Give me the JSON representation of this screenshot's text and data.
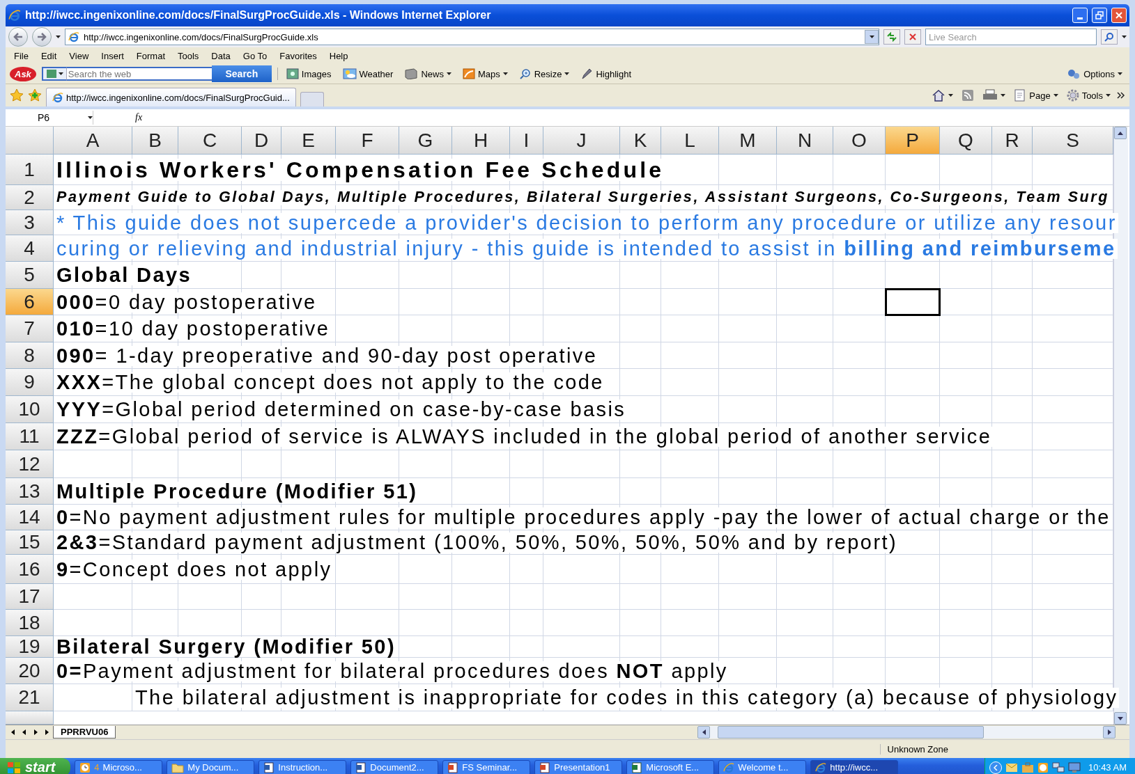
{
  "window": {
    "title": "http://iwcc.ingenixonline.com/docs/FinalSurgProcGuide.xls - Windows Internet Explorer"
  },
  "address_bar": {
    "url": "http://iwcc.ingenixonline.com/docs/FinalSurgProcGuide.xls",
    "search_placeholder": "Live Search"
  },
  "menu": [
    "File",
    "Edit",
    "View",
    "Insert",
    "Format",
    "Tools",
    "Data",
    "Go To",
    "Favorites",
    "Help"
  ],
  "ask_toolbar": {
    "logo": "Ask",
    "search_placeholder": "Search the web",
    "search_button": "Search",
    "options": "Options",
    "buttons": [
      {
        "label": "Images",
        "kind": "images",
        "dropdown": false
      },
      {
        "label": "Weather",
        "kind": "weather",
        "dropdown": false
      },
      {
        "label": "News",
        "kind": "news",
        "dropdown": true
      },
      {
        "label": "Maps",
        "kind": "maps",
        "dropdown": true
      },
      {
        "label": "Resize",
        "kind": "resize",
        "dropdown": true
      },
      {
        "label": "Highlight",
        "kind": "highlight",
        "dropdown": false
      }
    ]
  },
  "tabs": [
    {
      "label": "http://iwcc.ingenixonline.com/docs/FinalSurgProcGuid...",
      "selected": true
    }
  ],
  "command_bar": [
    "Page",
    "Tools"
  ],
  "formula_bar": {
    "name_box": "P6",
    "fx": "fx"
  },
  "columns": [
    {
      "label": "A",
      "selected": false
    },
    {
      "label": "B",
      "selected": false
    },
    {
      "label": "C",
      "selected": false
    },
    {
      "label": "D",
      "selected": false
    },
    {
      "label": "E",
      "selected": false
    },
    {
      "label": "F",
      "selected": false
    },
    {
      "label": "G",
      "selected": false
    },
    {
      "label": "H",
      "selected": false
    },
    {
      "label": "I",
      "selected": false
    },
    {
      "label": "J",
      "selected": false
    },
    {
      "label": "K",
      "selected": false
    },
    {
      "label": "L",
      "selected": false
    },
    {
      "label": "M",
      "selected": false
    },
    {
      "label": "N",
      "selected": false
    },
    {
      "label": "O",
      "selected": false
    },
    {
      "label": "P",
      "selected": true
    },
    {
      "label": "Q",
      "selected": false
    },
    {
      "label": "R",
      "selected": false
    },
    {
      "label": "S",
      "selected": false
    }
  ],
  "rows": [
    {
      "number": "1",
      "selected": false,
      "kind": "title",
      "indented": false,
      "text": "Illinois Workers' Compensation Fee Schedule"
    },
    {
      "number": "2",
      "selected": false,
      "kind": "subtitle",
      "indented": false,
      "text": "Payment Guide to Global Days, Multiple Procedures, Bilateral Surgeries, Assistant Surgeons, Co-Surgeons, Team Surg"
    },
    {
      "number": "3",
      "selected": false,
      "kind": "note",
      "indented": false,
      "text": "* This guide does not supercede a provider's decision to perform any procedure or utilize any resour"
    },
    {
      "number": "4",
      "selected": false,
      "kind": "note",
      "indented": false,
      "text": "curing or relieving and industrial injury - this guide is intended to assist in **billing and reimburseme**"
    },
    {
      "number": "5",
      "selected": false,
      "kind": "heading",
      "indented": false,
      "text": "Global Days"
    },
    {
      "number": "6",
      "selected": true,
      "kind": "body",
      "indented": false,
      "text": "**000**=0 day postoperative"
    },
    {
      "number": "7",
      "selected": false,
      "kind": "body",
      "indented": false,
      "text": "**010**=10 day postoperative"
    },
    {
      "number": "8",
      "selected": false,
      "kind": "body",
      "indented": false,
      "text": "**090**= 1-day preoperative and 90-day post operative"
    },
    {
      "number": "9",
      "selected": false,
      "kind": "body",
      "indented": false,
      "text": "**XXX**=The global concept does not apply to the code"
    },
    {
      "number": "10",
      "selected": false,
      "kind": "body",
      "indented": false,
      "text": "**YYY**=Global period determined on case-by-case basis"
    },
    {
      "number": "11",
      "selected": false,
      "kind": "body",
      "indented": false,
      "text": "**ZZZ**=Global period of service is ALWAYS included in the global period of another service"
    },
    {
      "number": "12",
      "selected": false
    },
    {
      "number": "13",
      "selected": false,
      "kind": "heading",
      "indented": false,
      "text": "Multiple Procedure (Modifier 51)"
    },
    {
      "number": "14",
      "selected": false,
      "kind": "body",
      "indented": false,
      "text": "**0**=No payment adjustment rules for multiple procedures apply -pay the lower of actual charge or the"
    },
    {
      "number": "15",
      "selected": false,
      "kind": "body",
      "indented": false,
      "text": "**2&3**=Standard payment adjustment (100%, 50%, 50%, 50%, 50% and by report)"
    },
    {
      "number": "16",
      "selected": false,
      "kind": "body",
      "indented": false,
      "text": "**9**=Concept does not apply"
    },
    {
      "number": "17",
      "selected": false
    },
    {
      "number": "18",
      "selected": false
    },
    {
      "number": "19",
      "selected": false,
      "kind": "heading",
      "indented": false,
      "text": "Bilateral Surgery (Modifier 50)"
    },
    {
      "number": "20",
      "selected": false,
      "kind": "body",
      "indented": false,
      "text": "**0=**Payment adjustment for bilateral procedures does **NOT** apply"
    },
    {
      "number": "21",
      "selected": false,
      "kind": "body",
      "indented": true,
      "text": "The bilateral adjustment is inappropriate for codes in this category (a) because of physiology"
    }
  ],
  "sheet_tabs": [
    {
      "label": "PPRRVU06",
      "selected": true
    }
  ],
  "status_bar": {
    "zone": "Unknown Zone"
  },
  "taskbar": {
    "start": "start",
    "clock": "10:43 AM",
    "items": [
      {
        "count": "4",
        "label": "Microso...",
        "kind": "group",
        "selected": false
      },
      {
        "label": "My Docum...",
        "kind": "folder",
        "selected": false
      },
      {
        "label": "Instruction...",
        "kind": "word",
        "selected": false
      },
      {
        "label": "Document2...",
        "kind": "word",
        "selected": false
      },
      {
        "label": "FS Seminar...",
        "kind": "powerpoint",
        "selected": false
      },
      {
        "label": "Presentation1",
        "kind": "powerpoint",
        "selected": false
      },
      {
        "label": "Microsoft E...",
        "kind": "excel",
        "selected": false
      },
      {
        "label": "Welcome t...",
        "kind": "ie",
        "selected": false
      },
      {
        "label": "http://iwcc...",
        "kind": "ie",
        "selected": true
      }
    ]
  }
}
